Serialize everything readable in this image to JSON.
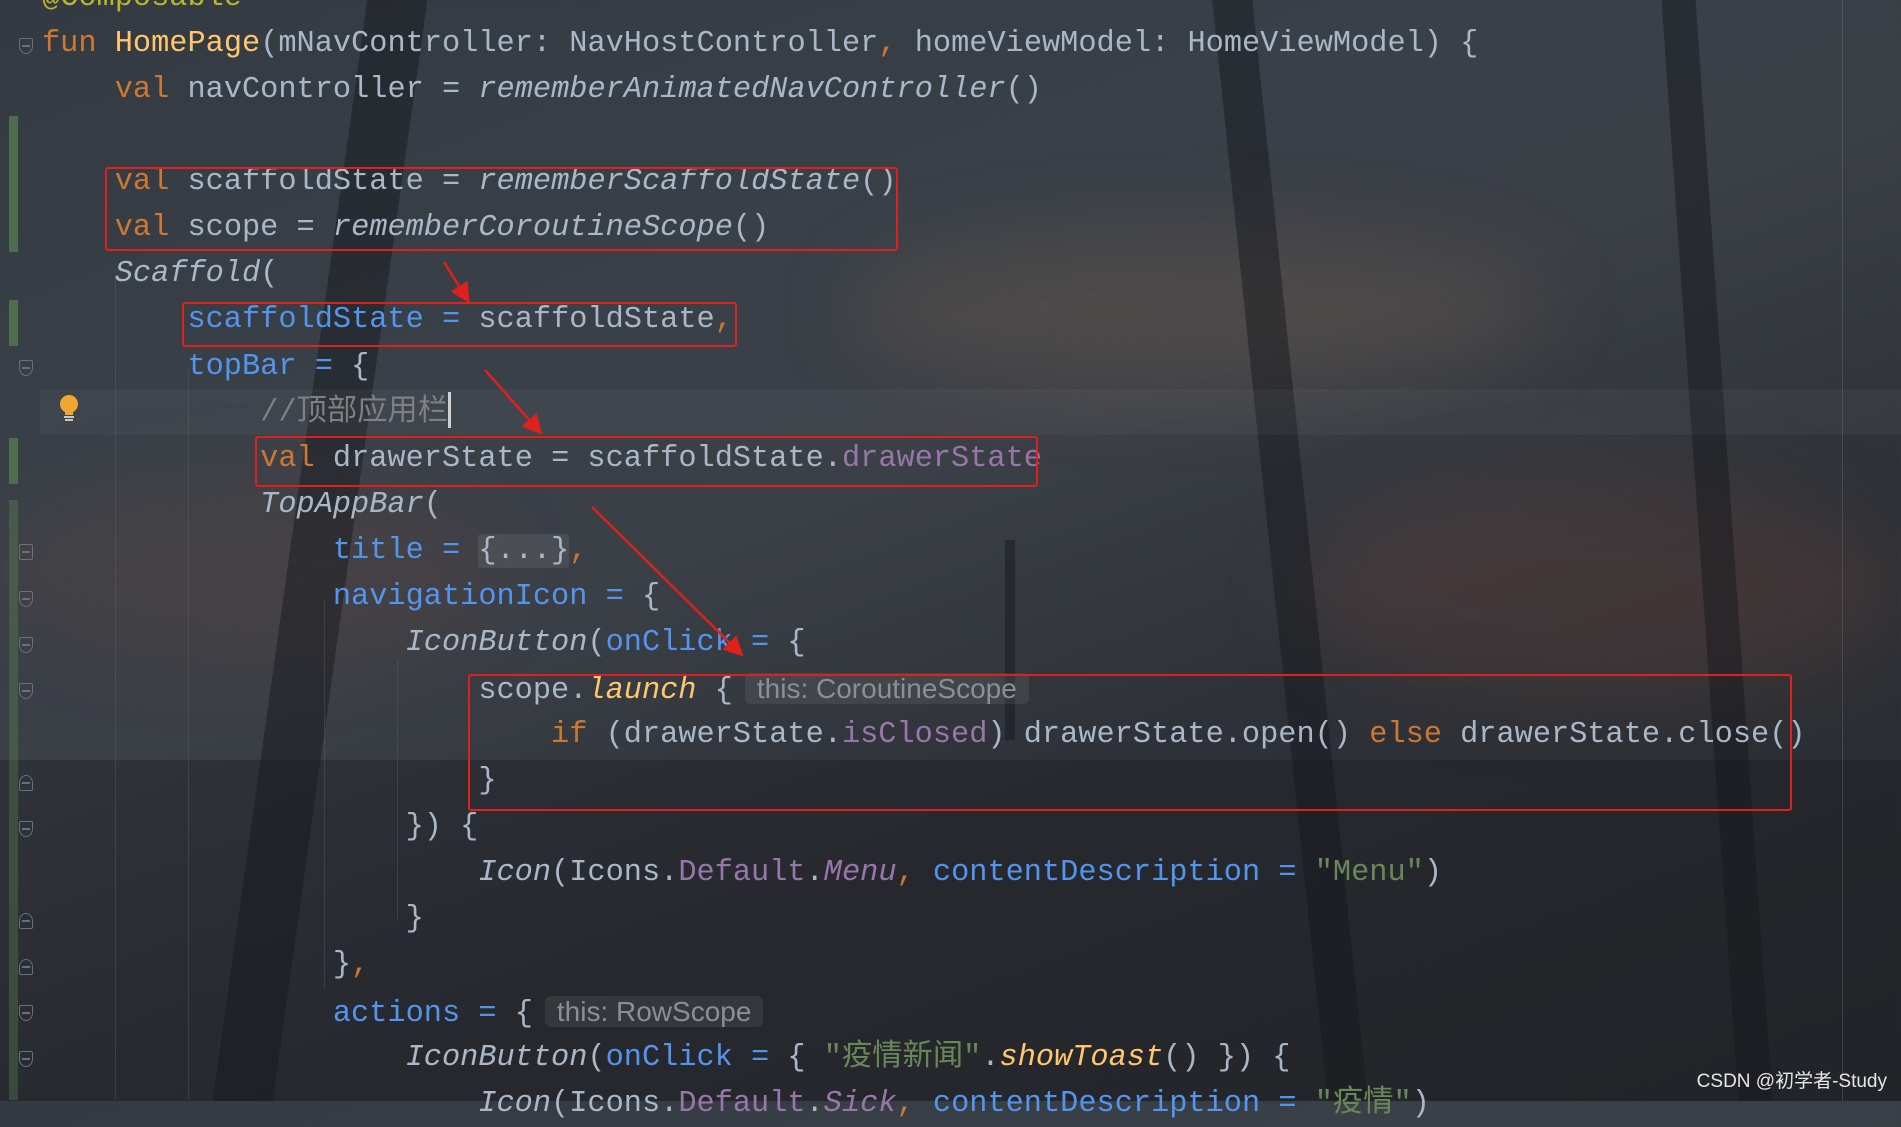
{
  "editor": {
    "lines": [
      {
        "indent": 0,
        "tokens": [
          [
            "@Composable",
            "ann"
          ]
        ]
      },
      {
        "indent": 0,
        "tokens": [
          [
            "fun ",
            "kw"
          ],
          [
            "HomePage",
            "fn"
          ],
          [
            "(mNavController: NavHostController",
            "id"
          ],
          [
            ", ",
            "comma"
          ],
          [
            "homeViewModel: HomeViewModel) {",
            "id"
          ]
        ]
      },
      {
        "indent": 4,
        "tokens": [
          [
            "val ",
            "kw"
          ],
          [
            "navController = ",
            "id"
          ],
          [
            "rememberAnimatedNavController",
            "it"
          ],
          [
            "()",
            "id"
          ]
        ]
      },
      {
        "indent": 0,
        "tokens": []
      },
      {
        "indent": 4,
        "tokens": [
          [
            "val ",
            "kw"
          ],
          [
            "scaffoldState = ",
            "id"
          ],
          [
            "rememberScaffoldState",
            "it"
          ],
          [
            "()",
            "id"
          ]
        ]
      },
      {
        "indent": 4,
        "tokens": [
          [
            "val ",
            "kw"
          ],
          [
            "scope = ",
            "id"
          ],
          [
            "rememberCoroutineScope",
            "it"
          ],
          [
            "()",
            "id"
          ]
        ]
      },
      {
        "indent": 4,
        "tokens": [
          [
            "Scaffold",
            "it"
          ],
          [
            "(",
            "id"
          ]
        ]
      },
      {
        "indent": 8,
        "tokens": [
          [
            "scaffoldState = ",
            "param"
          ],
          [
            "scaffoldState",
            "id"
          ],
          [
            ",",
            "comma"
          ]
        ]
      },
      {
        "indent": 8,
        "tokens": [
          [
            "topBar = ",
            "param"
          ],
          [
            "{",
            "id"
          ]
        ]
      },
      {
        "indent": 12,
        "tokens": [
          [
            "//顶部应用栏",
            "cm"
          ]
        ],
        "caret": true
      },
      {
        "indent": 12,
        "tokens": [
          [
            "val ",
            "kw"
          ],
          [
            "drawerState = scaffoldState.",
            "id"
          ],
          [
            "drawerState",
            "prop"
          ]
        ]
      },
      {
        "indent": 12,
        "tokens": [
          [
            "TopAppBar",
            "it"
          ],
          [
            "(",
            "id"
          ]
        ]
      },
      {
        "indent": 16,
        "tokens": [
          [
            "title = ",
            "param"
          ],
          [
            "{...}",
            "fold-text"
          ],
          [
            ",",
            "comma"
          ]
        ]
      },
      {
        "indent": 16,
        "tokens": [
          [
            "navigationIcon = ",
            "param"
          ],
          [
            "{",
            "id"
          ]
        ]
      },
      {
        "indent": 20,
        "tokens": [
          [
            "IconButton",
            "it"
          ],
          [
            "(",
            "id"
          ],
          [
            "onClick = ",
            "param"
          ],
          [
            "{",
            "id"
          ]
        ]
      },
      {
        "indent": 24,
        "tokens": [
          [
            "scope.",
            "id"
          ],
          [
            "launch",
            "ext"
          ],
          [
            " {",
            "id"
          ],
          [
            "this: CoroutineScope",
            "hint"
          ]
        ]
      },
      {
        "indent": 28,
        "tokens": [
          [
            "if ",
            "kw"
          ],
          [
            "(drawerState.",
            "id"
          ],
          [
            "isClosed",
            "prop"
          ],
          [
            ") drawerState.open() ",
            "id"
          ],
          [
            "else ",
            "kw"
          ],
          [
            "drawerState.close()",
            "id"
          ]
        ]
      },
      {
        "indent": 24,
        "tokens": [
          [
            "}",
            "id"
          ]
        ]
      },
      {
        "indent": 20,
        "tokens": [
          [
            "}) {",
            "id"
          ]
        ]
      },
      {
        "indent": 24,
        "tokens": [
          [
            "Icon",
            "it"
          ],
          [
            "(Icons.",
            "id"
          ],
          [
            "Default",
            "prop"
          ],
          [
            ".",
            "id"
          ],
          [
            "Menu",
            "propit"
          ],
          [
            ", ",
            "comma"
          ],
          [
            "contentDescription = ",
            "param"
          ],
          [
            "\"Menu\"",
            "str"
          ],
          [
            ")",
            "id"
          ]
        ]
      },
      {
        "indent": 20,
        "tokens": [
          [
            "}",
            "id"
          ]
        ]
      },
      {
        "indent": 16,
        "tokens": [
          [
            "}",
            "id"
          ],
          [
            ",",
            "comma"
          ]
        ]
      },
      {
        "indent": 16,
        "tokens": [
          [
            "actions = ",
            "param"
          ],
          [
            "{",
            "id"
          ],
          [
            "this: RowScope",
            "hint"
          ]
        ]
      },
      {
        "indent": 20,
        "tokens": [
          [
            "IconButton",
            "it"
          ],
          [
            "(",
            "id"
          ],
          [
            "onClick = ",
            "param"
          ],
          [
            "{ ",
            "id"
          ],
          [
            "\"疫情新闻\"",
            "str"
          ],
          [
            ".",
            "id"
          ],
          [
            "showToast",
            "ext"
          ],
          [
            "() }) {",
            "id"
          ]
        ]
      },
      {
        "indent": 24,
        "tokens": [
          [
            "Icon",
            "it"
          ],
          [
            "(Icons.",
            "id"
          ],
          [
            "Default",
            "prop"
          ],
          [
            ".",
            "id"
          ],
          [
            "Sick",
            "propit"
          ],
          [
            ", ",
            "comma"
          ],
          [
            "contentDescription = ",
            "param"
          ],
          [
            "\"疫情\"",
            "str"
          ],
          [
            ")",
            "id"
          ]
        ]
      }
    ]
  },
  "annotation_color": "#e0201c",
  "watermark": "CSDN @初学者-Study"
}
